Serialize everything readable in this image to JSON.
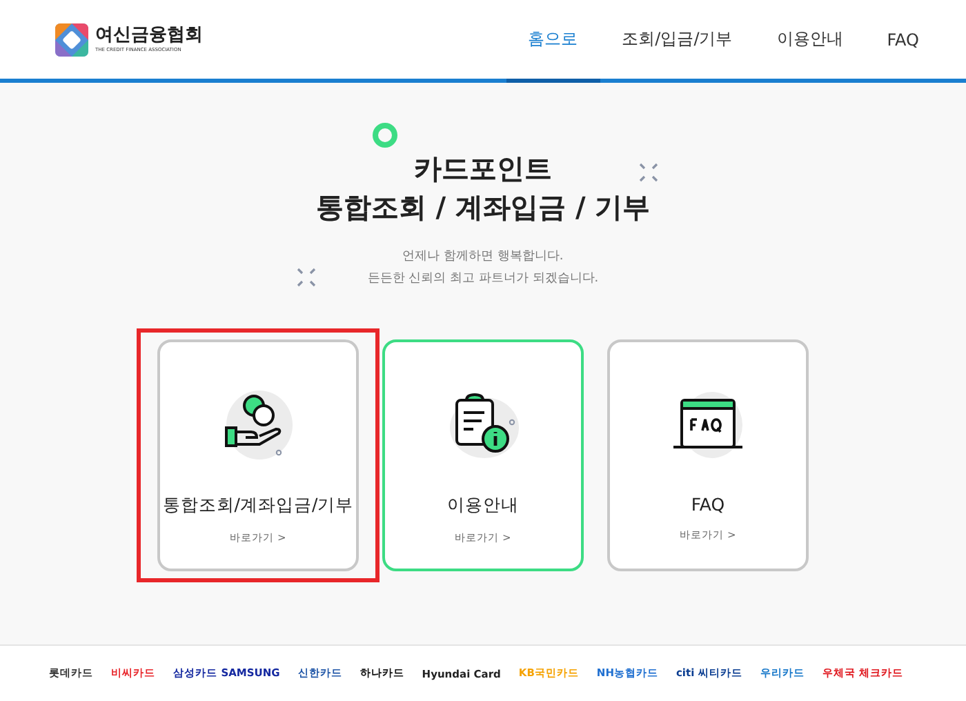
{
  "header": {
    "logo": {
      "name": "여신금융협회",
      "subtitle": "THE CREDIT FINANCE ASSOCIATION"
    },
    "nav": [
      {
        "label": "홈으로",
        "selected": true
      },
      {
        "label": "조회/입금/기부",
        "selected": false
      },
      {
        "label": "이용안내",
        "selected": false
      },
      {
        "label": "FAQ",
        "selected": false
      }
    ]
  },
  "hero": {
    "title_lines": [
      "카드포인트",
      "통합조회 / 계좌입금 / 기부"
    ],
    "subtitle_lines": [
      "언제나 함께하면 행복합니다.",
      "든든한 신뢰의 최고 파트너가 되겠습니다."
    ]
  },
  "cards": [
    {
      "kind": "coins",
      "title": "통합조회/계좌입금/기부",
      "link": "바로가기 >",
      "hovered": false,
      "annotated": true
    },
    {
      "kind": "info",
      "title": "이용안내",
      "link": "바로가기 >",
      "hovered": true,
      "annotated": false
    },
    {
      "kind": "faq",
      "title": "FAQ",
      "link": "바로가기 >",
      "hovered": false,
      "annotated": false
    }
  ],
  "footer": {
    "card_companies": [
      {
        "name": "롯데카드",
        "color": "#333333"
      },
      {
        "name": "비씨카드",
        "color": "#e8262b"
      },
      {
        "name": "삼성카드 SAMSUNG",
        "color": "#1428a0"
      },
      {
        "name": "신한카드",
        "color": "#2157a8"
      },
      {
        "name": "하나카드",
        "color": "#111111"
      },
      {
        "name": "Hyundai Card",
        "color": "#222222"
      },
      {
        "name": "KB국민카드",
        "color": "#f5a200"
      },
      {
        "name": "NH농협카드",
        "color": "#1f6fd0"
      },
      {
        "name": "citi 씨티카드",
        "color": "#0a3d91"
      },
      {
        "name": "우리카드",
        "color": "#1677c9"
      },
      {
        "name": "우체국 체크카드",
        "color": "#e0161d"
      }
    ]
  }
}
